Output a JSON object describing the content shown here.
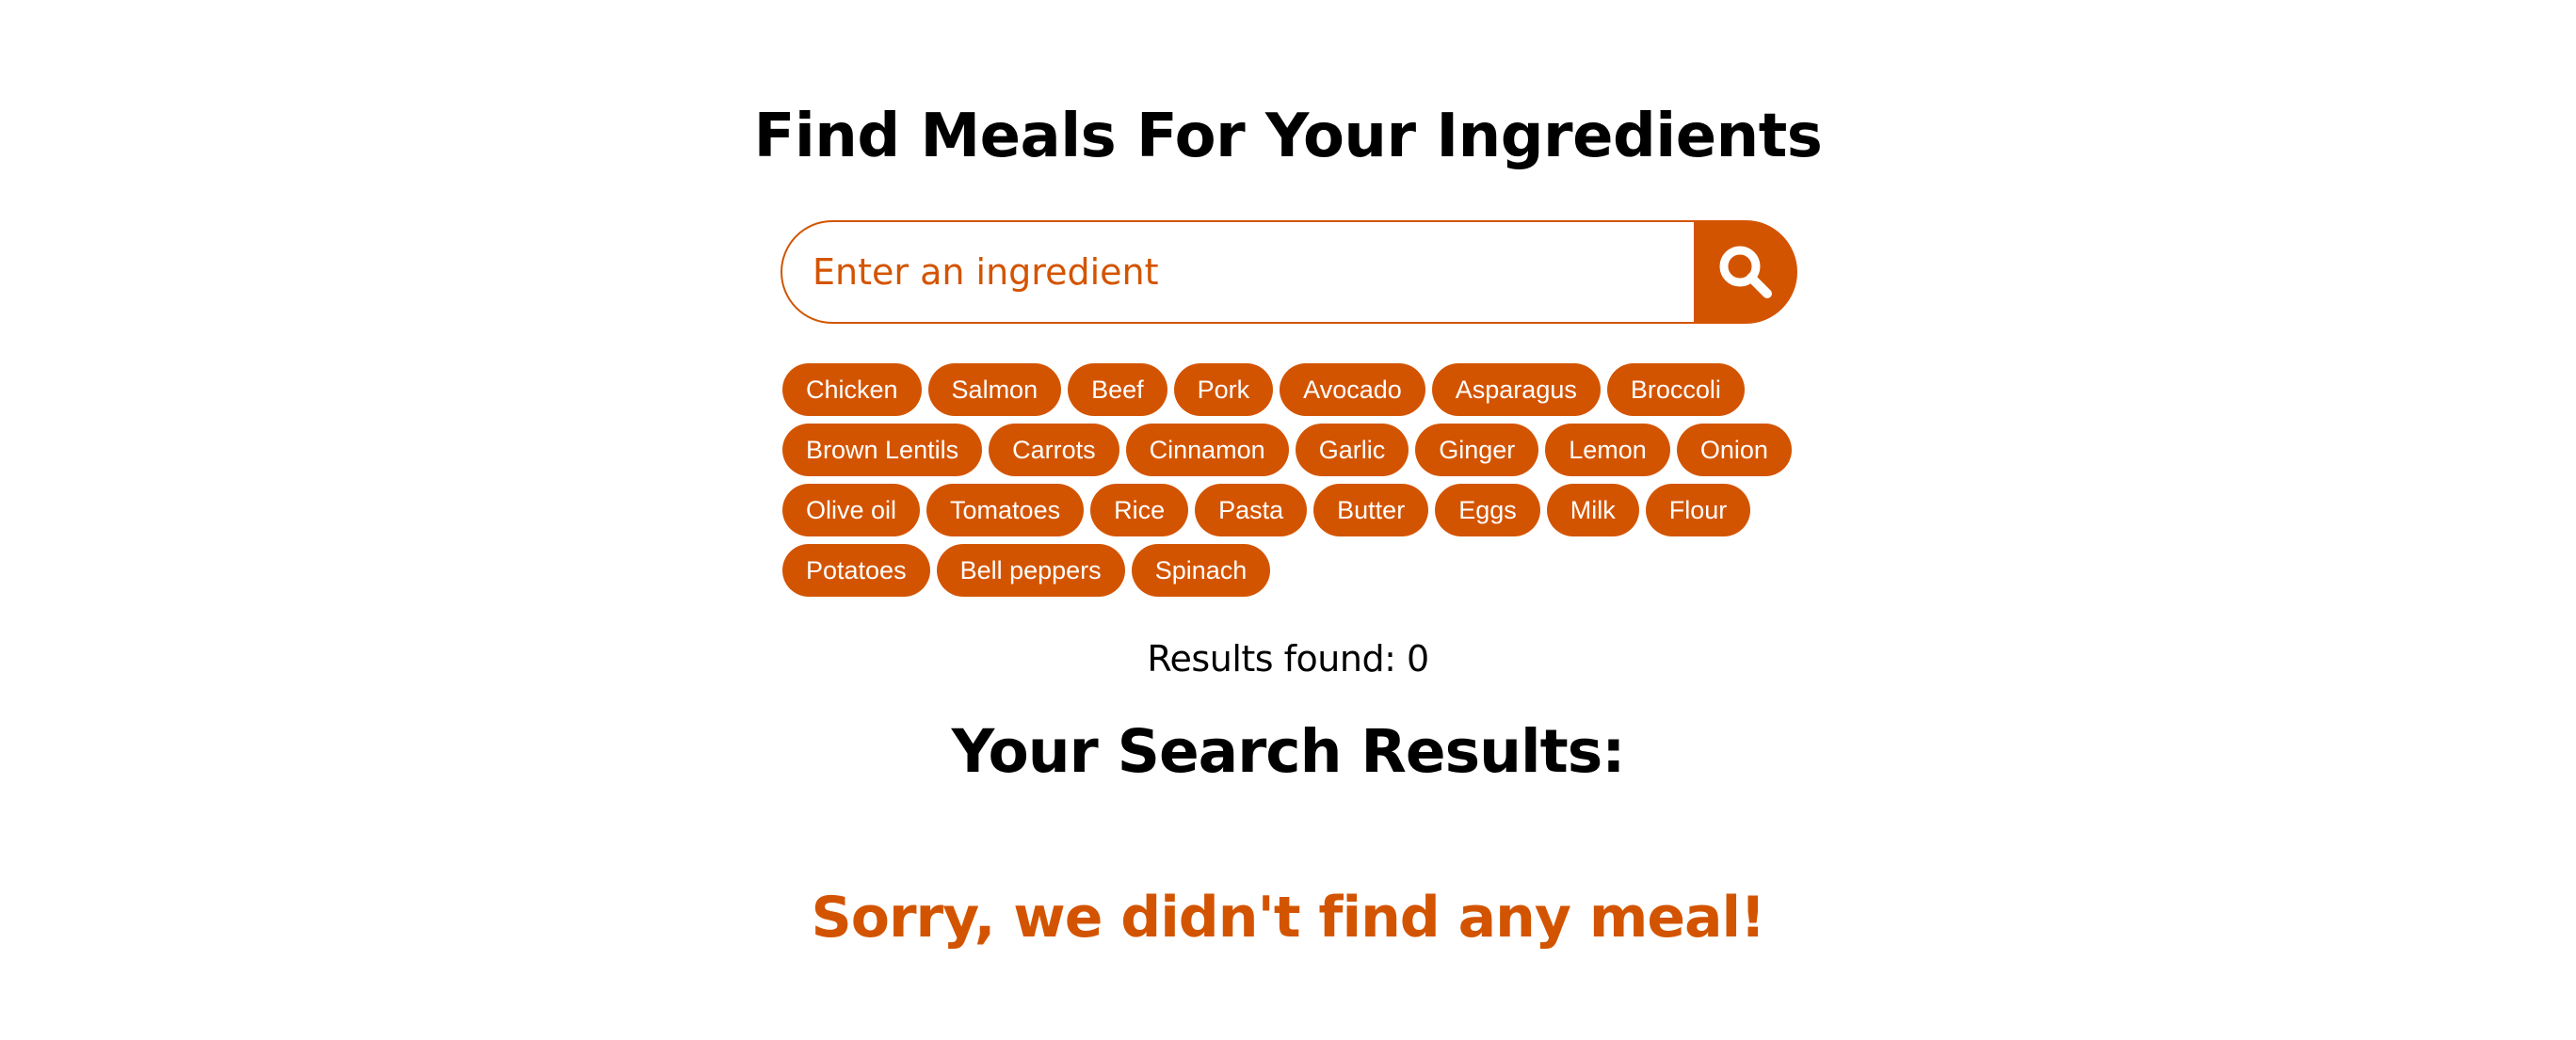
{
  "colors": {
    "accent": "#d35400",
    "text": "#000000",
    "background": "#ffffff"
  },
  "title": "Find Meals For Your Ingredients",
  "search": {
    "placeholder": "Enter an ingredient",
    "value": "",
    "button_icon": "search-icon"
  },
  "ingredients": [
    [
      "Chicken",
      "Salmon",
      "Beef",
      "Pork",
      "Avocado",
      "Asparagus",
      "Broccoli"
    ],
    [
      "Brown Lentils",
      "Carrots",
      "Cinnamon",
      "Garlic",
      "Ginger",
      "Lemon",
      "Onion"
    ],
    [
      "Olive oil",
      "Tomatoes",
      "Rice",
      "Pasta",
      "Butter",
      "Eggs",
      "Milk",
      "Flour"
    ],
    [
      "Potatoes",
      "Bell peppers",
      "Spinach"
    ]
  ],
  "results": {
    "count_text": "Results found: 0",
    "heading": "Your Search Results:",
    "empty_message": "Sorry, we didn't find any meal!"
  }
}
